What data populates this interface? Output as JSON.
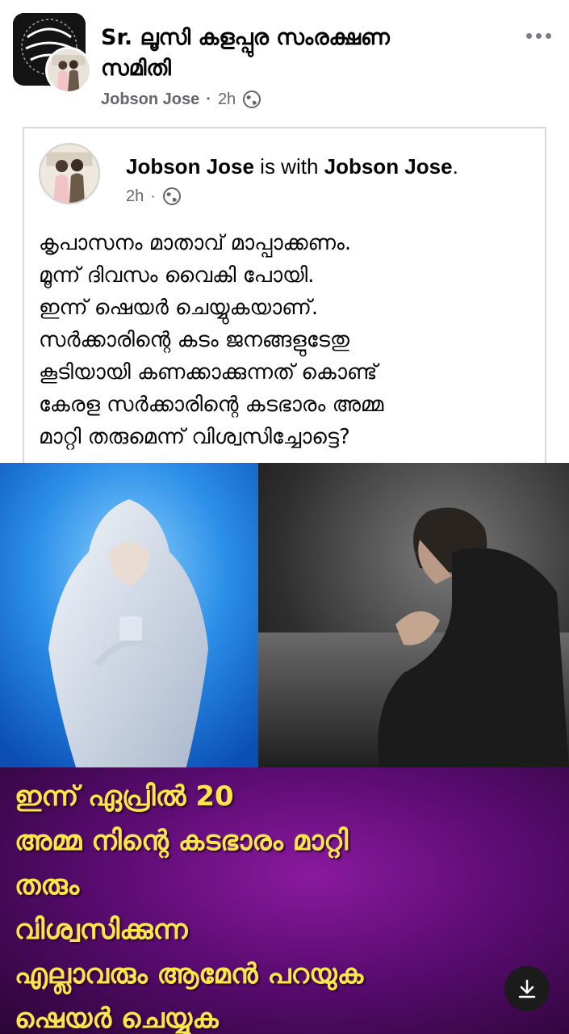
{
  "post": {
    "group_name_line1": "Sr. ലൂസി കളപ്പുര സംരക്ഷണ",
    "group_name_line2": "സമിതി",
    "author": "Jobson Jose",
    "separator": "·",
    "time": "2h",
    "more_icon": "more-horizontal-icon",
    "privacy_icon": "globe-icon"
  },
  "shared_post": {
    "author": "Jobson Jose",
    "with_text": " is with ",
    "tagged": "Jobson Jose",
    "period": ".",
    "separator": "·",
    "time": "2h",
    "text_lines": [
      "കൃപാസനം മാതാവ് മാപ്പാക്കണം.",
      "മൂന്ന് ദിവസം വൈകി പോയി.",
      "ഇന്ന് ഷെയർ ചെയ്യുകയാണ്.",
      "സർക്കാരിന്റെ കടം ജനങ്ങളുടേതു",
      "കൂടിയായി കണക്കാക്കുന്നത് കൊണ്ട്",
      "കേരള സർക്കാരിന്റെ കടഭാരം അമ്മ",
      "മാറ്റി തരുമെന്ന് വിശ്വസിച്ചോട്ടെ?"
    ]
  },
  "image": {
    "caption_lines": [
      "ഇന്ന് ഏപ്രിൽ 20",
      "അമ്മ നിന്റെ കടഭാരം മാറ്റി",
      "തരും",
      "വിശ്വസിക്കുന്ന",
      "എല്ലാവരും ആമേൻ പറയുക",
      "ഷെയർ ചെയ്യുക"
    ],
    "caption_color": "#fde44b",
    "download_icon": "download-icon"
  }
}
